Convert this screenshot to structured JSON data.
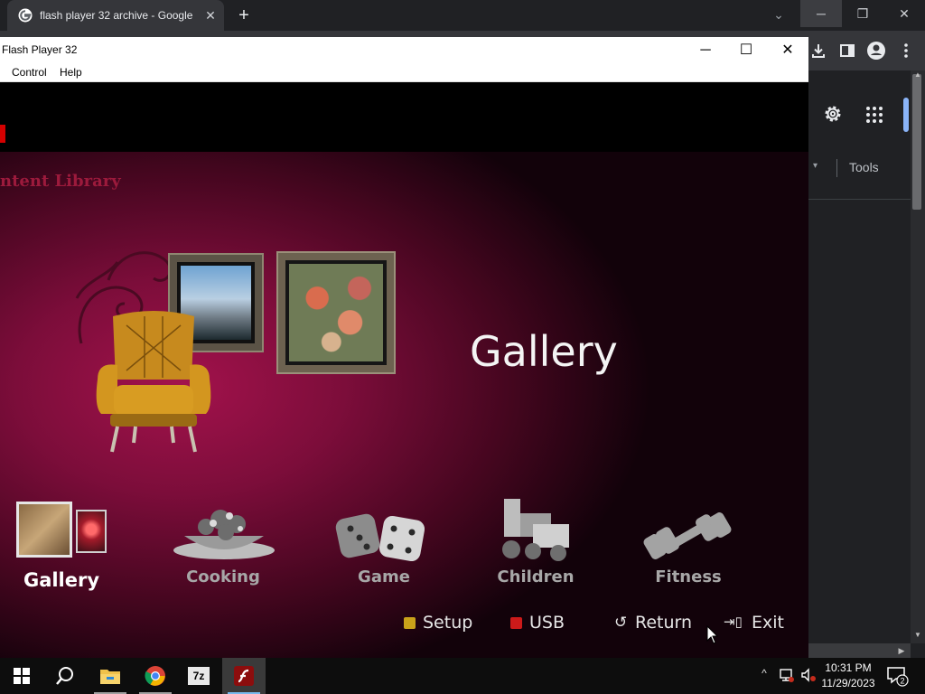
{
  "browser": {
    "tab_title": "flash player 32 archive - Google",
    "tab_close": "✕",
    "new_tab": "+",
    "tab_search": "⌄",
    "min": "─",
    "restore": "❐",
    "close": "✕",
    "toolbar_icons": [
      "download-icon",
      "side-panel-icon",
      "profile-icon",
      "menu-icon"
    ],
    "page": {
      "tools_label": "Tools",
      "tools_caret": "▾",
      "accent_color": "#8ab4f8"
    }
  },
  "flash_window": {
    "title": "Flash Player 32",
    "minimize": "─",
    "maximize": "☐",
    "close": "✕",
    "menu": [
      "Control",
      "Help"
    ]
  },
  "app": {
    "content_library": "ntent Library",
    "heading": "Gallery",
    "categories": [
      {
        "label": "Gallery",
        "icon": "gallery-icon",
        "selected": true
      },
      {
        "label": "Cooking",
        "icon": "cooking-icon",
        "selected": false
      },
      {
        "label": "Game",
        "icon": "dice-icon",
        "selected": false
      },
      {
        "label": "Children",
        "icon": "toy-train-icon",
        "selected": false
      },
      {
        "label": "Fitness",
        "icon": "dumbbell-icon",
        "selected": false
      }
    ],
    "controls": {
      "setup": "Setup",
      "setup_color": "#c9a21a",
      "usb": "USB",
      "usb_color": "#cc1a1a",
      "return": "Return",
      "return_icon": "↺",
      "exit": "Exit",
      "exit_icon": "⇥▯"
    }
  },
  "taskbar": {
    "apps": [
      "start-icon",
      "search-icon",
      "file-explorer-icon",
      "chrome-icon",
      "7zip-icon",
      "flash-icon"
    ],
    "sevenzip_label": "7z",
    "tray_chevron": "^",
    "time": "10:31 PM",
    "date": "11/29/2023",
    "notification_count": "2"
  }
}
